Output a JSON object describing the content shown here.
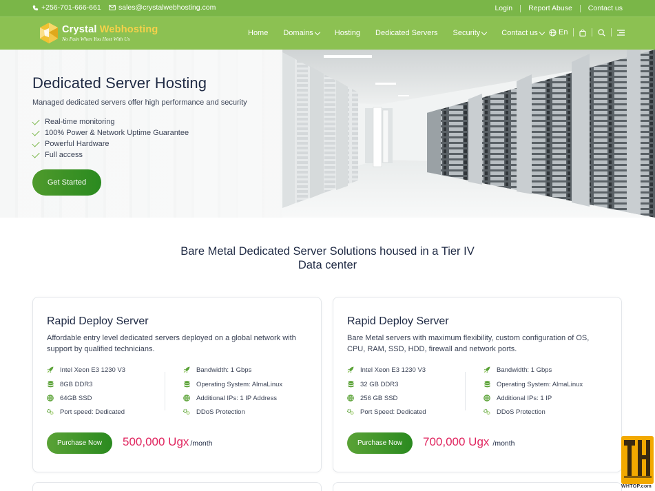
{
  "topbar": {
    "phone": "+256-701-666-661",
    "email": "sales@crystalwebhosting.com",
    "links": [
      "Login",
      "Report Abuse",
      "Contact us"
    ]
  },
  "brand": {
    "name_part1": "Crystal ",
    "name_part2": "Webhosting",
    "tagline": "No Pain When You Host With Us"
  },
  "nav": {
    "items": [
      {
        "label": "Home"
      },
      {
        "label": "Domains"
      },
      {
        "label": "Hosting"
      },
      {
        "label": "Dedicated Servers"
      },
      {
        "label": "Security"
      },
      {
        "label": "Contact us"
      }
    ],
    "language": "En",
    "icons": [
      "globe-icon",
      "cart-icon",
      "search-icon",
      "menu-icon"
    ]
  },
  "hero": {
    "title": "Dedicated Server Hosting",
    "subtitle": "Managed dedicated servers offer high performance and security",
    "features": [
      "Real-time monitoring",
      "100% Power & Network Uptime Guarantee",
      "Powerful Hardware",
      "Full access"
    ],
    "cta": "Get Started"
  },
  "section": {
    "title_line1": "Bare Metal Dedicated Server Solutions housed in a Tier IV",
    "title_line2": "Data center"
  },
  "plans": [
    {
      "title": "Rapid Deploy Server",
      "description": "Affordable entry level dedicated servers deployed on a global network with support by qualified technicians.",
      "left_features": [
        "Intel Xeon E3 1230 V3",
        "8GB DDR3",
        "64GB SSD",
        "Port speed: Dedicated"
      ],
      "right_features": [
        "Bandwidth: 1 Gbps",
        "Operating System: AlmaLinux",
        "Additional IPs: 1 IP Address",
        "DDoS Protection"
      ],
      "button": "Purchase Now",
      "price": "500,000 Ugx",
      "period": "/month"
    },
    {
      "title": "Rapid Deploy Server",
      "description": "Bare Metal servers with maximum flexibility, custom configuration of OS, CPU, RAM, SSD, HDD, firewall and network ports.",
      "left_features": [
        "Intel Xeon E3 1230 V3",
        "32 GB DDR3",
        "256 GB SSD",
        "Port Speed: Dedicated"
      ],
      "right_features": [
        "Bandwidth: 1 Gbps",
        "Operating System: AlmaLinux",
        "Additional IPs: 1 IP",
        "DDoS Protection"
      ],
      "button": "Purchase Now",
      "price": "700,000 Ugx",
      "period": "/month"
    }
  ],
  "feature_icons": [
    "rocket-icon",
    "database-icon",
    "network-icon",
    "gears-icon"
  ],
  "colors": {
    "brand_green": "#8cc152",
    "topbar_green": "#7ab648",
    "button_green": "#2a8a1f",
    "price_pink": "#e0245e",
    "heading_navy": "#1f2a44"
  },
  "watermark": {
    "label": "WHTOP.com"
  }
}
